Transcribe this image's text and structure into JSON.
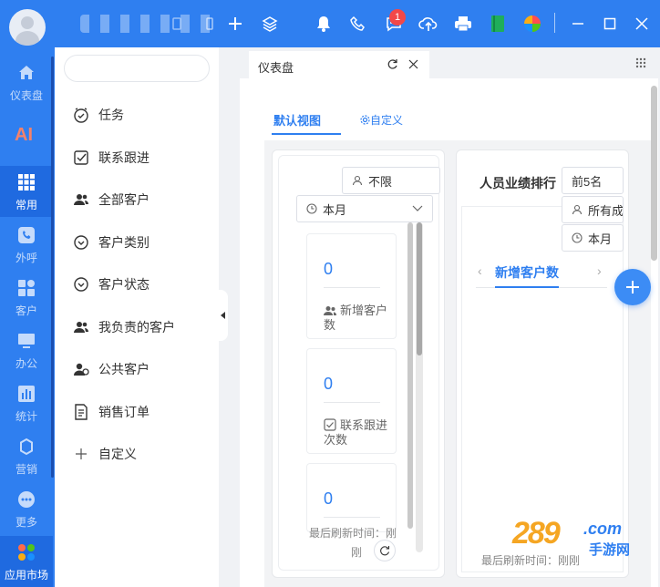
{
  "topbar": {
    "notification_count": "1",
    "icons": [
      "add-icon",
      "layers-icon",
      "bell-icon",
      "phone-icon",
      "message-icon",
      "cloud-upload-icon",
      "printer-icon",
      "book-icon",
      "colorful-app-icon",
      "minimize-icon",
      "maximize-icon",
      "close-icon"
    ]
  },
  "leftnav": {
    "items": [
      {
        "label": "仪表盘",
        "icon": "home-icon"
      },
      {
        "label": "",
        "icon": "ai-icon"
      },
      {
        "label": "常用",
        "icon": "grid-icon",
        "active": true
      },
      {
        "label": "外呼",
        "icon": "phone-icon"
      },
      {
        "label": "客户",
        "icon": "apps-icon"
      },
      {
        "label": "办公",
        "icon": "monitor-icon"
      },
      {
        "label": "统计",
        "icon": "chart-icon"
      },
      {
        "label": "营销",
        "icon": "marketing-icon"
      },
      {
        "label": "更多",
        "icon": "more-icon"
      },
      {
        "label": "应用市场",
        "icon": "market-icon"
      }
    ]
  },
  "sidebar": {
    "items": [
      {
        "label": "任务",
        "icon": "clock-icon"
      },
      {
        "label": "联系跟进",
        "icon": "checkbox-icon"
      },
      {
        "label": "全部客户",
        "icon": "users-icon"
      },
      {
        "label": "客户类别",
        "icon": "circle-chevron-icon"
      },
      {
        "label": "客户状态",
        "icon": "circle-chevron-icon"
      },
      {
        "label": "我负责的客户",
        "icon": "users-icon"
      },
      {
        "label": "公共客户",
        "icon": "user-public-icon"
      },
      {
        "label": "销售订单",
        "icon": "order-icon"
      },
      {
        "label": "自定义",
        "icon": "plus-icon"
      }
    ]
  },
  "tab": {
    "title": "仪表盘"
  },
  "views": {
    "default": "默认视图",
    "custom": "自定义"
  },
  "panel1": {
    "filter_user": "不限",
    "filter_period": "本月",
    "stats": [
      {
        "value": "0",
        "label": "新增客户数"
      },
      {
        "value": "0",
        "label": "联系跟进次数"
      },
      {
        "value": "0",
        "label": ""
      }
    ],
    "refresh_line1": "最后刷新时间：刚",
    "refresh_line2": "刚"
  },
  "panel2": {
    "title": "人员业绩排行",
    "filter_top": "前5名",
    "filter_members": "所有成",
    "filter_period": "本月",
    "subtab": "新增客户数",
    "refresh": "最后刷新时间：刚刚"
  },
  "watermark": {
    "brand": "289",
    "suffix": ".com",
    "cn": "手游网"
  }
}
